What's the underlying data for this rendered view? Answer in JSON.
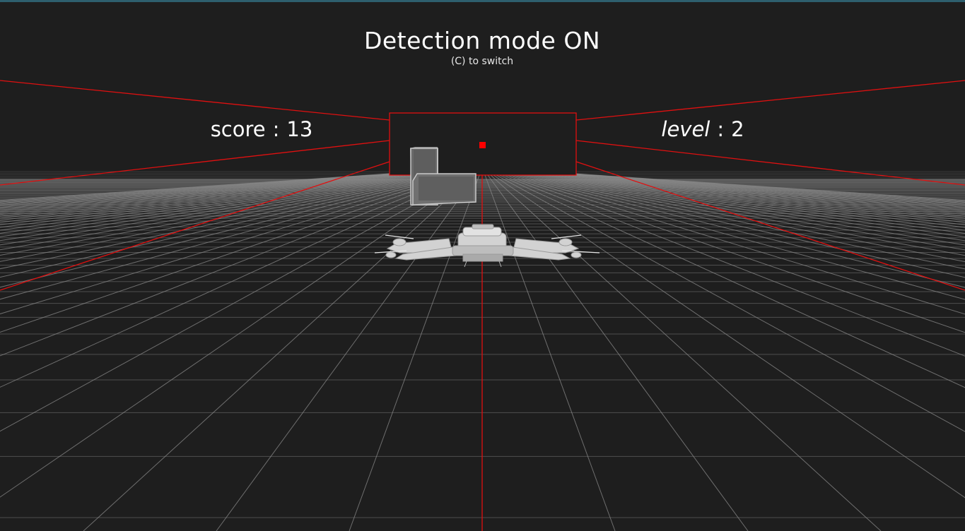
{
  "hud": {
    "mode_title": "Detection mode ON",
    "mode_hint": "(C) to switch",
    "score_label": "score",
    "score_sep": ":",
    "score_value": "13",
    "level_label": "level",
    "level_sep": ":",
    "level_value": "2"
  },
  "colors": {
    "background": "#1e1e1e",
    "top_strip": "#2e5f6e",
    "grid": "#8a8a8a",
    "detection": "#e01010",
    "target_marker": "#ff0000",
    "obstacle": "#b4b4b4",
    "drone": "#d2d2d2",
    "text": "#ffffff"
  },
  "scene": {
    "drone_icon": "drone-icon",
    "obstacle_icon": "l-block-obstacle-icon",
    "target_icon": "red-square-marker-icon"
  }
}
